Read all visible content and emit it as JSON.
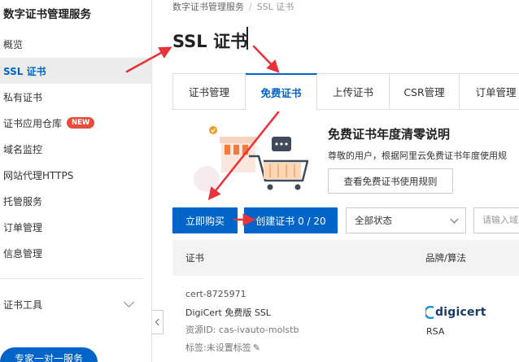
{
  "sidebar": {
    "title": "数字证书管理服务",
    "items": [
      {
        "label": "概览"
      },
      {
        "label": "SSL 证书"
      },
      {
        "label": "私有证书"
      },
      {
        "label": "证书应用仓库",
        "badge": "NEW"
      },
      {
        "label": "域名监控"
      },
      {
        "label": "网站代理HTTPS"
      },
      {
        "label": "托管服务"
      },
      {
        "label": "订单管理"
      },
      {
        "label": "信息管理"
      }
    ],
    "tools_label": "证书工具",
    "expert_button": "专家一对一服务"
  },
  "breadcrumb": [
    "数字证书管理服务",
    "SSL 证书"
  ],
  "page_title": "SSL 证书",
  "tabs": [
    "证书管理",
    "免费证书",
    "上传证书",
    "CSR管理",
    "订单管理"
  ],
  "promo": {
    "title": "免费证书年度清零说明",
    "desc": "尊敬的用户，根据阿里云免费证书年度使用规",
    "button": "查看免费证书使用规则"
  },
  "toolbar": {
    "buy_button": "立即购买",
    "create_button": "创建证书 0 / 20",
    "status_select": "全部状态",
    "search_placeholder": "请输入域"
  },
  "table": {
    "headers": [
      "证书",
      "品牌/算法"
    ],
    "rows": [
      {
        "cert_id": "cert-8725971",
        "name": "DigiCert 免费版 SSL",
        "resource": "资源ID: cas-ivauto-molstb",
        "tag": "标签:未设置标签",
        "brand": "digicert",
        "algorithm": "RSA"
      }
    ]
  },
  "colors": {
    "primary": "#0064c8",
    "arrow": "#e8333a",
    "new_badge": "#e84c3d",
    "active_nav_bg": "#ececec"
  }
}
